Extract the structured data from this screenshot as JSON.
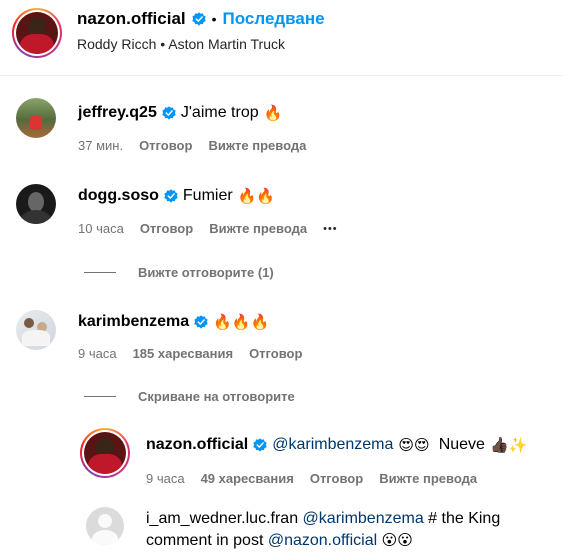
{
  "header": {
    "username": "nazon.official",
    "dot": "•",
    "follow_label": "Последване",
    "music": "Roddy Ricch • Aston Martin Truck"
  },
  "comments": [
    {
      "username": "jeffrey.q25",
      "text": "J'aime trop",
      "emoji": "🔥",
      "time": "37 мин.",
      "reply_label": "Отговор",
      "translate_label": "Вижте превода"
    },
    {
      "username": "dogg.soso",
      "text": "Fumier",
      "emoji": "🔥🔥",
      "time": "10 часа",
      "reply_label": "Отговор",
      "translate_label": "Вижте превода",
      "more": "•••"
    },
    {
      "username": "karimbenzema",
      "emoji": "🔥🔥🔥",
      "time": "9 часа",
      "likes": "185 харесвания",
      "reply_label": "Отговор"
    }
  ],
  "view_replies": "Вижте отговорите (1)",
  "hide_replies": "Скриване на отговорите",
  "replies": [
    {
      "username": "nazon.official",
      "mention": "@karimbenzema",
      "emoji1": "😍😍",
      "text": "Nueve",
      "emoji2": "👍🏿✨",
      "time": "9 часа",
      "likes": "49 харесвания",
      "reply_label": "Отговор",
      "translate_label": "Вижте превода"
    },
    {
      "username": "i_am_wedner.luc.fran",
      "mention": "@karimbenzema",
      "text1": "# the King",
      "text2": "comment in post",
      "mention2": "@nazon.official",
      "emoji": "😮😮"
    }
  ],
  "colors": {
    "link": "#0095f6",
    "mention": "#00376b",
    "meta": "#737373",
    "verified": "#0095f6"
  }
}
